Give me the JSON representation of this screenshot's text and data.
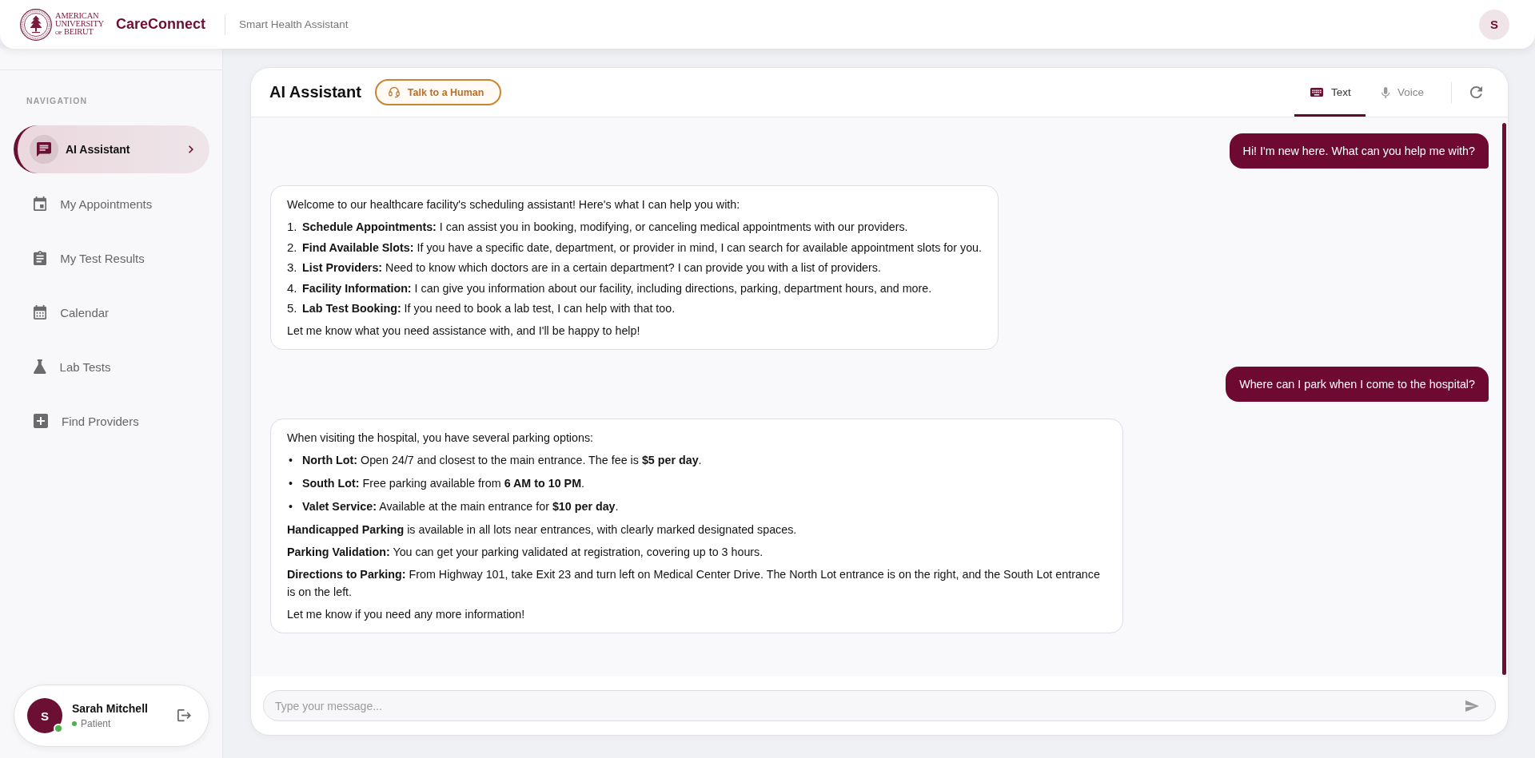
{
  "header": {
    "wordmark": {
      "line_1": "AMERICAN",
      "line_2": "UNIVERSITY",
      "line_3_prefix": "OF",
      "line_3": "BEIRUT"
    },
    "app_name": "CareConnect",
    "subtitle": "Smart Health Assistant",
    "avatar_initial": "S"
  },
  "sidebar": {
    "section_label": "NAVIGATION",
    "items": [
      {
        "label": "AI Assistant",
        "selected": true
      },
      {
        "label": "My Appointments",
        "selected": false
      },
      {
        "label": "My Test Results",
        "selected": false
      },
      {
        "label": "Calendar",
        "selected": false
      },
      {
        "label": "Lab Tests",
        "selected": false
      },
      {
        "label": "Find Providers",
        "selected": false
      }
    ],
    "user": {
      "avatar_initial": "S",
      "name": "Sarah Mitchell",
      "role": "Patient",
      "online": true
    }
  },
  "chat": {
    "title": "AI Assistant",
    "human_button": "Talk to a Human",
    "modes": [
      {
        "label": "Text",
        "selected": true
      },
      {
        "label": "Voice",
        "selected": false
      }
    ],
    "messages": [
      {
        "kind": "user",
        "text": "Hi! I'm new here. What can you help me with?"
      },
      {
        "kind": "assistant",
        "blocks": [
          {
            "kind": "paragraph",
            "text": "Welcome to our healthcare facility's scheduling assistant! Here's what I can help you with:"
          },
          {
            "kind": "numbered_list",
            "items": [
              {
                "marker": "1.",
                "text": "**Schedule Appointments:** I can assist you in booking, modifying, or canceling medical appointments with our providers."
              },
              {
                "marker": "2.",
                "text": "**Find Available Slots:** If you have a specific date, department, or provider in mind, I can search for available appointment slots for you."
              },
              {
                "marker": "3.",
                "text": "**List Providers:** Need to know which doctors are in a certain department? I can provide you with a list of providers."
              },
              {
                "marker": "4.",
                "text": "**Facility Information:** I can give you information about our facility, including directions, parking, department hours, and more."
              },
              {
                "marker": "5.",
                "text": "**Lab Test Booking:** If you need to book a lab test, I can help with that too."
              }
            ]
          },
          {
            "kind": "paragraph",
            "text": "Let me know what you need assistance with, and I'll be happy to help!"
          }
        ]
      },
      {
        "kind": "user",
        "text": "Where can I park when I come to the hospital?"
      },
      {
        "kind": "assistant",
        "blocks": [
          {
            "kind": "paragraph",
            "text": "When visiting the hospital, you have several parking options:"
          },
          {
            "kind": "bullet_list",
            "items": [
              {
                "marker": "•",
                "text": "**North Lot:** Open 24/7 and closest to the main entrance. The fee is **$5 per day**."
              },
              {
                "marker": "•",
                "text": "**South Lot:** Free parking available from **6 AM to 10 PM**."
              },
              {
                "marker": "•",
                "text": "**Valet Service:** Available at the main entrance for **$10 per day**."
              }
            ]
          },
          {
            "kind": "paragraph",
            "text": "**Handicapped Parking** is available in all lots near entrances, with clearly marked designated spaces."
          },
          {
            "kind": "paragraph",
            "text": "**Parking Validation:** You can get your parking validated at registration, covering up to 3 hours."
          },
          {
            "kind": "paragraph",
            "text": "**Directions to Parking:** From Highway 101, take Exit 23 and turn left on Medical Center Drive. The North Lot entrance is on the right, and the South Lot entrance is on the left."
          },
          {
            "kind": "paragraph",
            "text": "Let me know if you need any more information!"
          }
        ]
      }
    ],
    "input": {
      "placeholder": "Type your message..."
    }
  }
}
